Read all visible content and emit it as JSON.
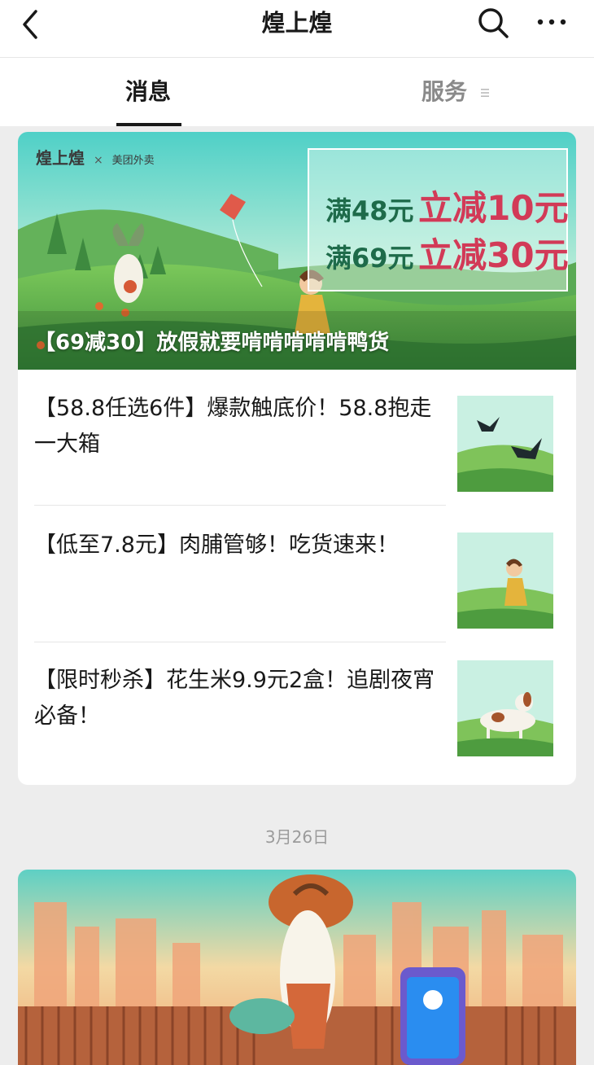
{
  "header": {
    "title": "煌上煌"
  },
  "tabs": [
    {
      "label": "消息"
    },
    {
      "label": "服务"
    }
  ],
  "featured": {
    "brand": "煌上煌",
    "partner": "美团外卖",
    "promo": [
      {
        "threshold": "满48元",
        "discount": "立减10元"
      },
      {
        "threshold": "满69元",
        "discount": "立减30元"
      }
    ],
    "caption": "【69减30】放假就要啃啃啃啃啃鸭货"
  },
  "articles": [
    {
      "title": "【58.8任选6件】爆款触底价！58.8抱走一大箱"
    },
    {
      "title": "【低至7.8元】肉脯管够！吃货速来！"
    },
    {
      "title": "【限时秒杀】花生米9.9元2盒！追剧夜宵必备！"
    }
  ],
  "date_separator": "3月26日",
  "colors": {
    "accent_red": "#d23a57",
    "accent_green": "#1e6b4a",
    "banner_sky": "#5ed0c4"
  }
}
